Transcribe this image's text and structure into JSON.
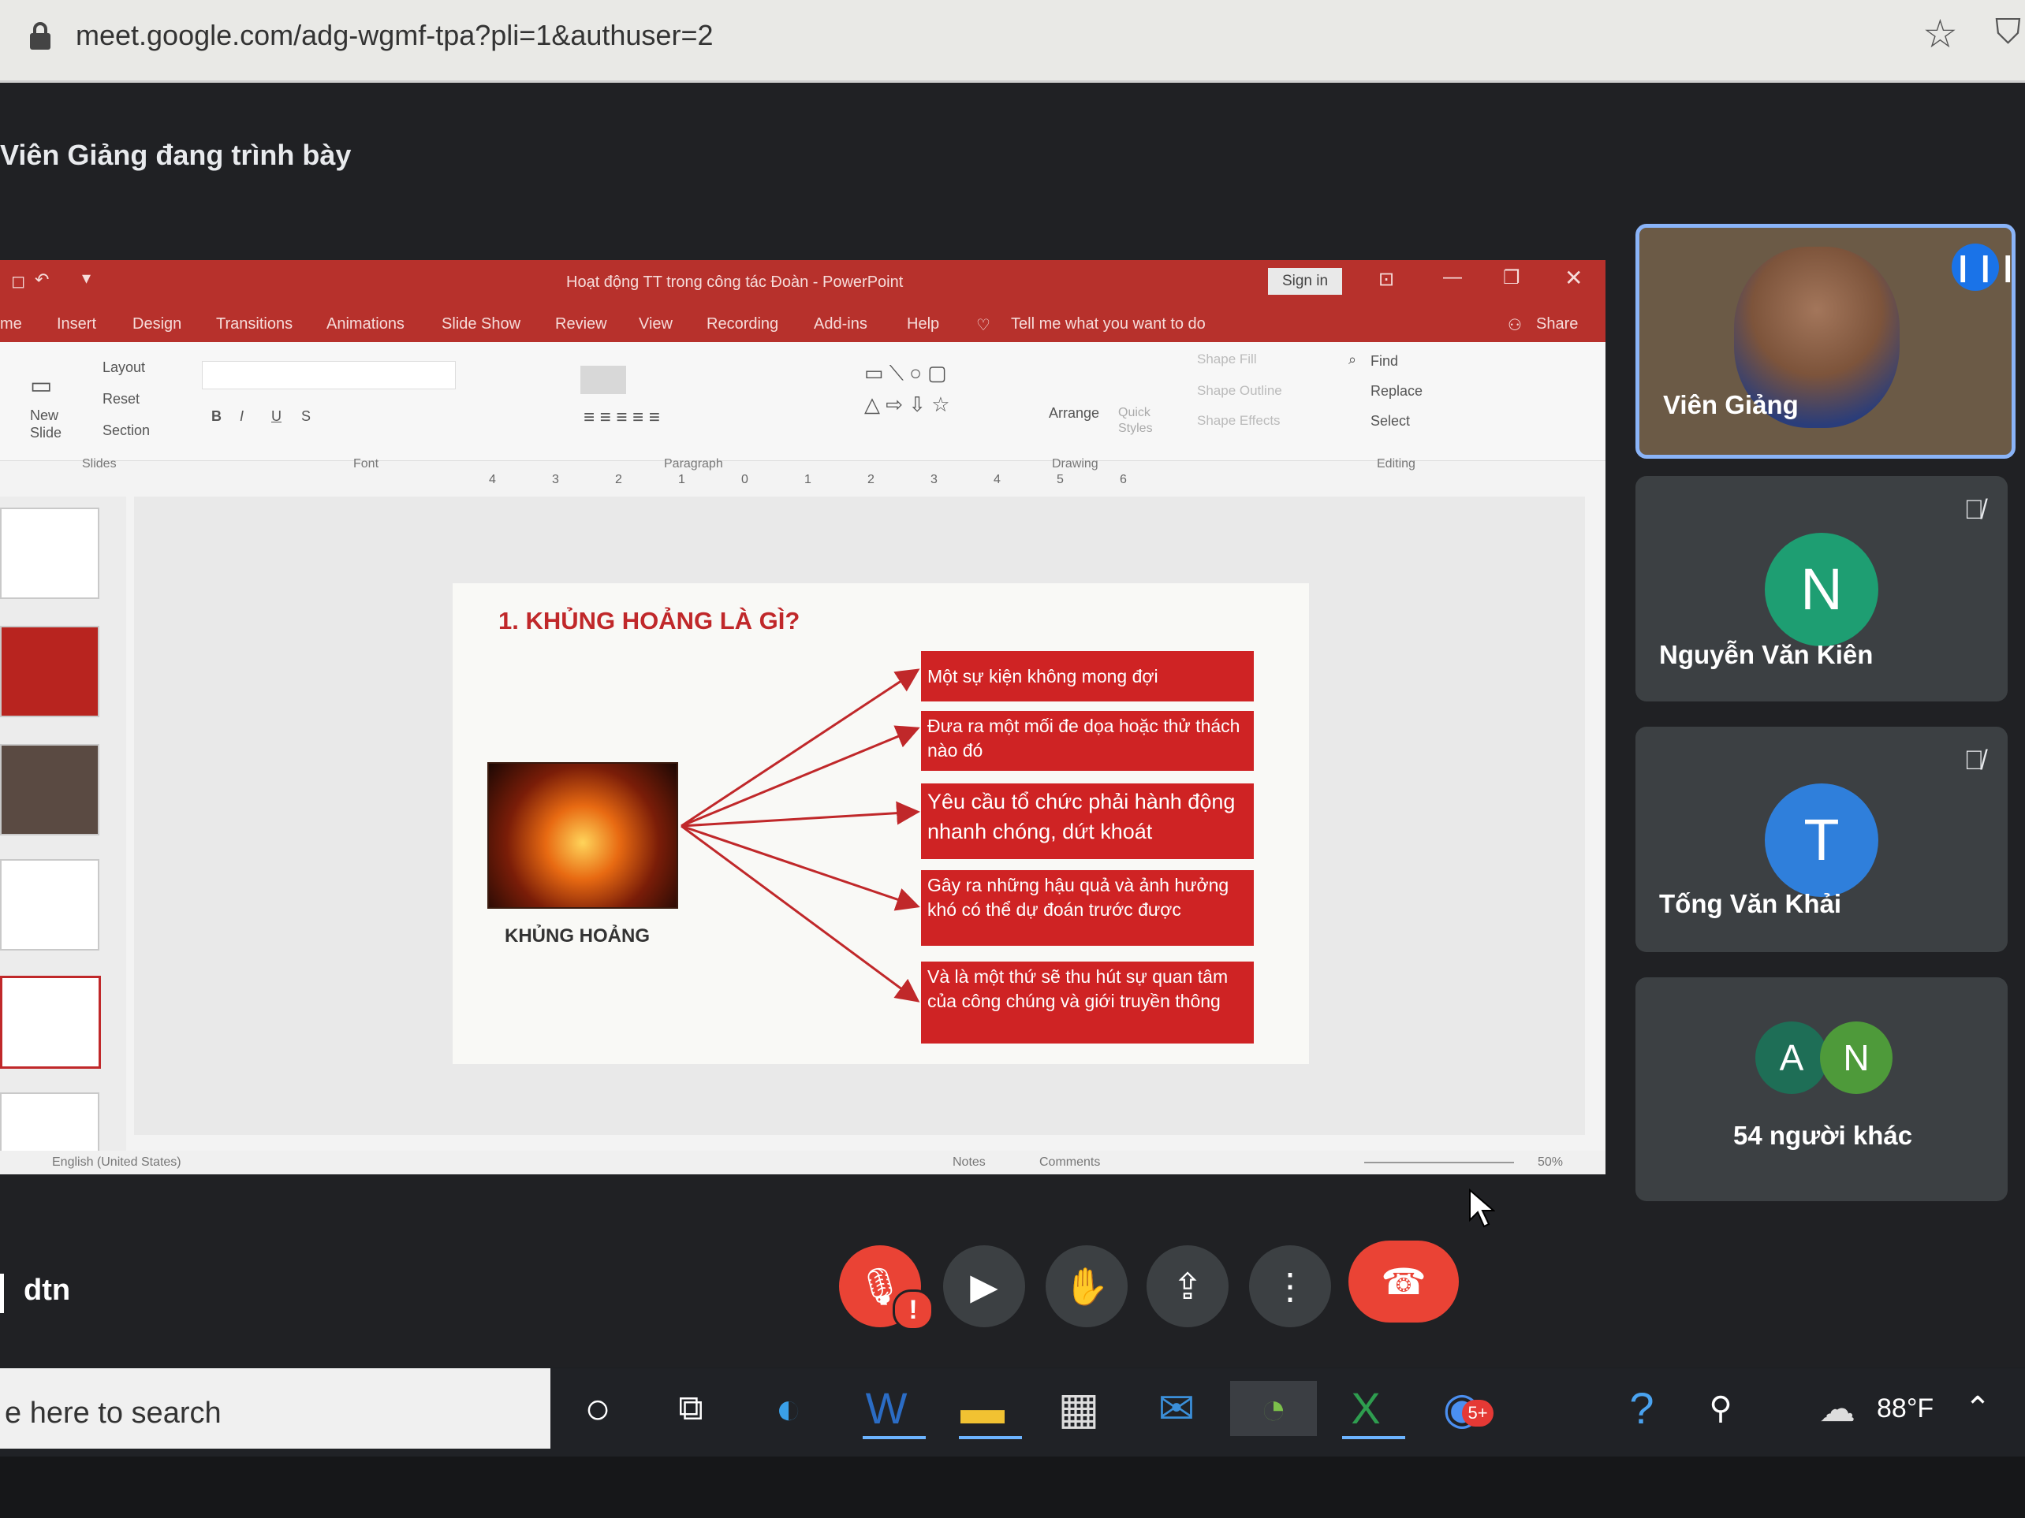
{
  "browser": {
    "url": "meet.google.com/adg-wgmf-tpa?pli=1&authuser=2"
  },
  "meet": {
    "presenting": "Viên Giảng đang trình bày",
    "meeting_label": "dtn",
    "participants": [
      {
        "name": "Viên Giảng"
      },
      {
        "name": "Nguyễn Văn Kiên",
        "initial": "N",
        "color": "#1e9e72"
      },
      {
        "name": "Tống Văn Khải",
        "initial": "T",
        "color": "#2f7fdb"
      }
    ],
    "others": {
      "label": "54 người khác",
      "initials": [
        "A",
        "N"
      ]
    }
  },
  "ppt": {
    "title": "Hoạt động TT trong công tác Đoàn  -  PowerPoint",
    "sign_in": "Sign in",
    "tabs": [
      "me",
      "Insert",
      "Design",
      "Transitions",
      "Animations",
      "Slide Show",
      "Review",
      "View",
      "Recording",
      "Add-ins",
      "Help"
    ],
    "tell_me": "Tell me what you want to do",
    "share": "Share",
    "ribbon": {
      "layout": "Layout",
      "reset": "Reset",
      "section": "Section",
      "new_slide": "New Slide",
      "arrange": "Arrange",
      "quick_styles": "Quick Styles",
      "shape_fill": "Shape Fill",
      "shape_outline": "Shape Outline",
      "shape_effects": "Shape Effects",
      "find": "Find",
      "replace": "Replace",
      "select": "Select",
      "groups": [
        "Slides",
        "Font",
        "Paragraph",
        "Drawing",
        "Editing"
      ]
    },
    "slide": {
      "heading": "1. KHỦNG HOẢNG LÀ GÌ?",
      "image_caption": "KHỦNG HOẢNG",
      "boxes": [
        "Một sự kiện không mong đợi",
        "Đưa ra một mối đe dọa hoặc thử thách nào đó",
        "Yêu cầu tổ chức phải hành động nhanh chóng, dứt khoát",
        "Gây ra những hậu quả và ảnh hưởng khó có thể dự đoán trước được",
        "Và là một thứ sẽ thu hút sự quan tâm của công chúng và giới truyền thông"
      ]
    },
    "status": {
      "language": "English (United States)",
      "notes": "Notes",
      "comments": "Comments",
      "zoom": "50%"
    }
  },
  "taskbar": {
    "search_placeholder": "e here to search",
    "weather": "88°F",
    "badge": "5+"
  }
}
